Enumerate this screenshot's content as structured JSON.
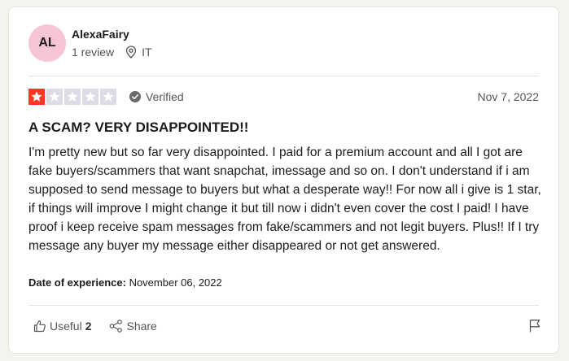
{
  "reviewer": {
    "initials": "AL",
    "name": "AlexaFairy",
    "reviews": "1 review",
    "country": "IT",
    "avatar_color": "#f7c5d4"
  },
  "review": {
    "rating": 1,
    "max_rating": 5,
    "star_colors": {
      "filled": "#ff3722",
      "empty": "#dcdce6"
    },
    "verified_label": "Verified",
    "date": "Nov 7, 2022",
    "title": "A SCAM? VERY DISAPPOINTED!!",
    "body": "I'm pretty new but so far very disappointed. I paid for a premium account and all I got are fake buyers/scammers that want snapchat, imessage and so on. I don't understand if i am supposed to send message to buyers but what a desperate way!! For now all i give is 1 star, if things will improve I might change it but till now i didn't even cover the cost I paid! I have proof i keep receive spam messages from fake/scammers and not legit buyers. Plus!! If I try message any buyer my message either disappeared or not get answered.",
    "experience_label": "Date of experience:",
    "experience_date": "November 06, 2022"
  },
  "actions": {
    "useful_label": "Useful",
    "useful_count": "2",
    "share_label": "Share",
    "icons": [
      "thumbs-up-icon",
      "share-icon",
      "flag-icon",
      "location-pin-icon",
      "verified-check-icon",
      "star-icon"
    ]
  }
}
